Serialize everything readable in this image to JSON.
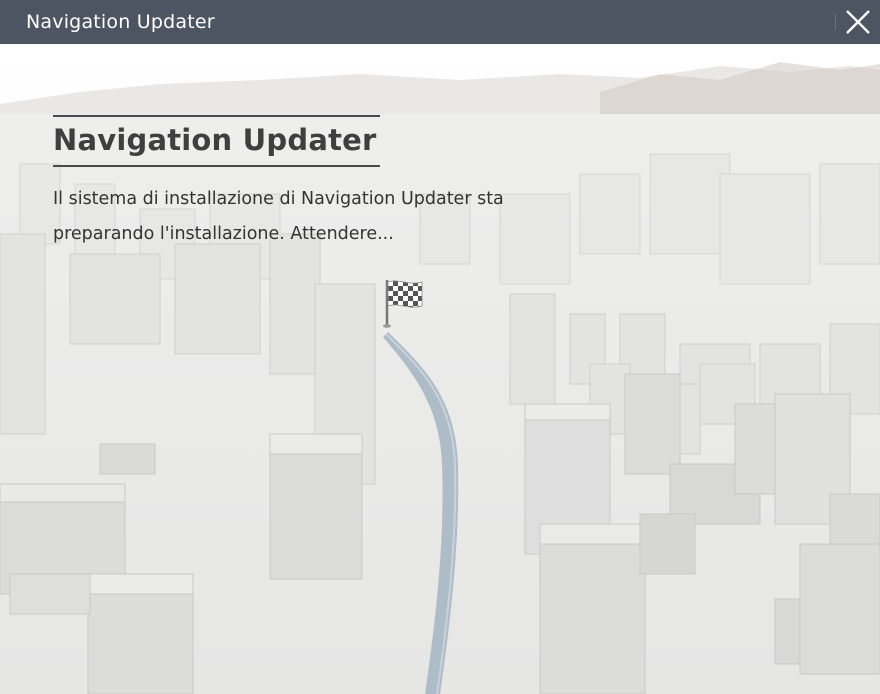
{
  "window": {
    "title": "Navigation Updater",
    "close_icon": "close-icon"
  },
  "main": {
    "heading": "Navigation Updater",
    "message": "Il sistema di installazione di Navigation Updater sta preparando l'installazione. Attendere..."
  },
  "illustration": {
    "destination_icon": "checkered-flag-icon",
    "route_color": "#aebcc8"
  },
  "colors": {
    "titlebar": "#4d5562",
    "heading_text": "#3f3f3f"
  }
}
